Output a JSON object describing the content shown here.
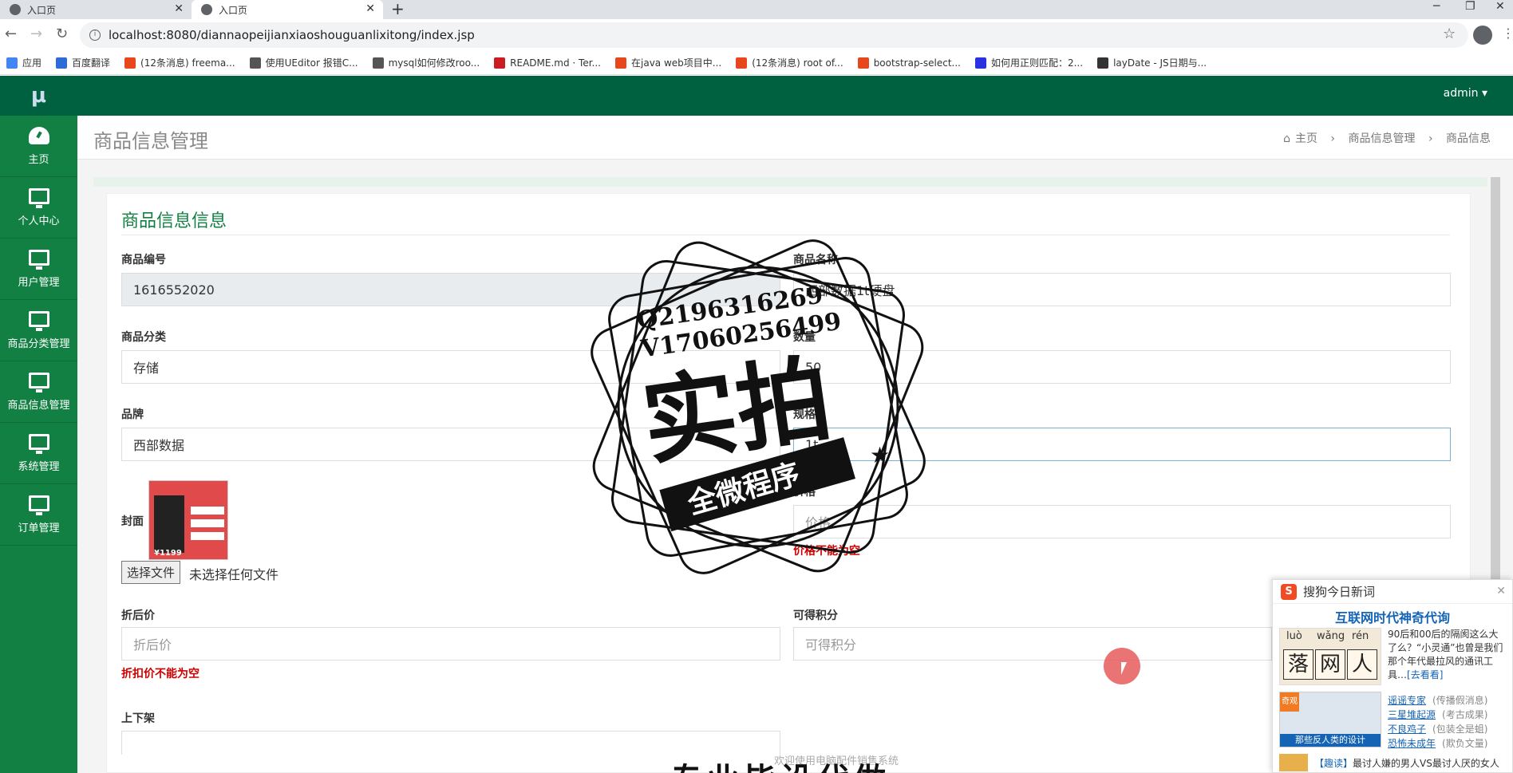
{
  "browser": {
    "tabs": [
      {
        "label": "入口页",
        "active": false
      },
      {
        "label": "入口页",
        "active": true
      }
    ],
    "url": "localhost:8080/diannaopeijianxiaoshouguanlixitong/index.jsp",
    "bookmarks": [
      {
        "label": "应用",
        "color": "#4285f4"
      },
      {
        "label": "百度翻译",
        "color": "#2d6bd6"
      },
      {
        "label": "(12条消息) freema...",
        "color": "#e8461c"
      },
      {
        "label": "使用UEditor 报错C...",
        "color": "#555555"
      },
      {
        "label": "mysql如何修改roo...",
        "color": "#555555"
      },
      {
        "label": "README.md · Ter...",
        "color": "#c71d23"
      },
      {
        "label": "在java web项目中...",
        "color": "#e8461c"
      },
      {
        "label": "(12条消息) root of...",
        "color": "#e8461c"
      },
      {
        "label": "bootstrap-select...",
        "color": "#e8461c"
      },
      {
        "label": "如何用正则匹配：2...",
        "color": "#2932e1"
      },
      {
        "label": "layDate - JS日期与...",
        "color": "#333333"
      }
    ]
  },
  "app": {
    "logo": "μ",
    "user_menu": "admin ▾",
    "sidebar": [
      {
        "label": "主页",
        "icon": "dashboard-icon"
      },
      {
        "label": "个人中心",
        "icon": "monitor-icon"
      },
      {
        "label": "用户管理",
        "icon": "monitor-icon"
      },
      {
        "label": "商品分类管理",
        "icon": "monitor-icon"
      },
      {
        "label": "商品信息管理",
        "icon": "monitor-icon"
      },
      {
        "label": "系统管理",
        "icon": "monitor-icon"
      },
      {
        "label": "订单管理",
        "icon": "monitor-icon"
      }
    ],
    "page_title": "商品信息管理",
    "breadcrumb": {
      "home": "主页",
      "level1": "商品信息管理",
      "level2": "商品信息",
      "sep": "›"
    },
    "card_title": "商品信息信息",
    "colors": {
      "sidebar": "#138043",
      "topbar": "#006140",
      "accent": "#138043",
      "error": "#cc0000"
    }
  },
  "form": {
    "product_no": {
      "label": "商品编号",
      "value": "1616552020"
    },
    "product_name": {
      "label": "商品名称",
      "value": "西部数据1t硬盘"
    },
    "category": {
      "label": "商品分类",
      "value": "存储"
    },
    "quantity": {
      "label": "数量",
      "value": "50"
    },
    "brand": {
      "label": "品牌",
      "value": "西部数据"
    },
    "spec": {
      "label": "规格",
      "value": "1t"
    },
    "cover": {
      "label": "封面",
      "choose_button": "选择文件",
      "no_file": "未选择任何文件",
      "image_price": "¥1199"
    },
    "price": {
      "label": "价格",
      "placeholder": "价格",
      "error": "价格不能为空"
    },
    "discount_price": {
      "label": "折后价",
      "placeholder": "折后价",
      "error": "折扣价不能为空"
    },
    "points": {
      "label": "可得积分",
      "placeholder": "可得积分"
    },
    "shelf": {
      "label": "上下架"
    }
  },
  "stamp": {
    "line1": "Q2196316269",
    "line2": "V17060256499",
    "main": "实拍",
    "banner": "全微程序"
  },
  "footer": {
    "text": "欢迎使用电脑配件销售系统",
    "big": "专业毕设代做"
  },
  "popup": {
    "title": "搜狗今日新词",
    "headline": "互联网时代神奇代询",
    "pinyin": [
      "luò",
      "wǎng",
      "rén"
    ],
    "hanzi": [
      "落",
      "网",
      "人"
    ],
    "summary": "90后和00后的隔阂这么大了么？“小灵通”也曾是我们那个年代最拉风的通讯工具…",
    "more": "[去看看]",
    "corner_tag": "奇观",
    "image_caption": "那些反人类的设计",
    "list": [
      {
        "title": "谣谣专家",
        "source": "(传播假消息)"
      },
      {
        "title": "三星堆起源",
        "source": "(考古成果)"
      },
      {
        "title": "不良鸡子",
        "source": "(包装全是蛆)"
      },
      {
        "title": "恐怖未成年",
        "source": "(欺负文量)"
      }
    ],
    "bottom_tag": "【趣读】",
    "bottom_text": "最讨人嫌的男人VS最讨人厌的女人"
  }
}
